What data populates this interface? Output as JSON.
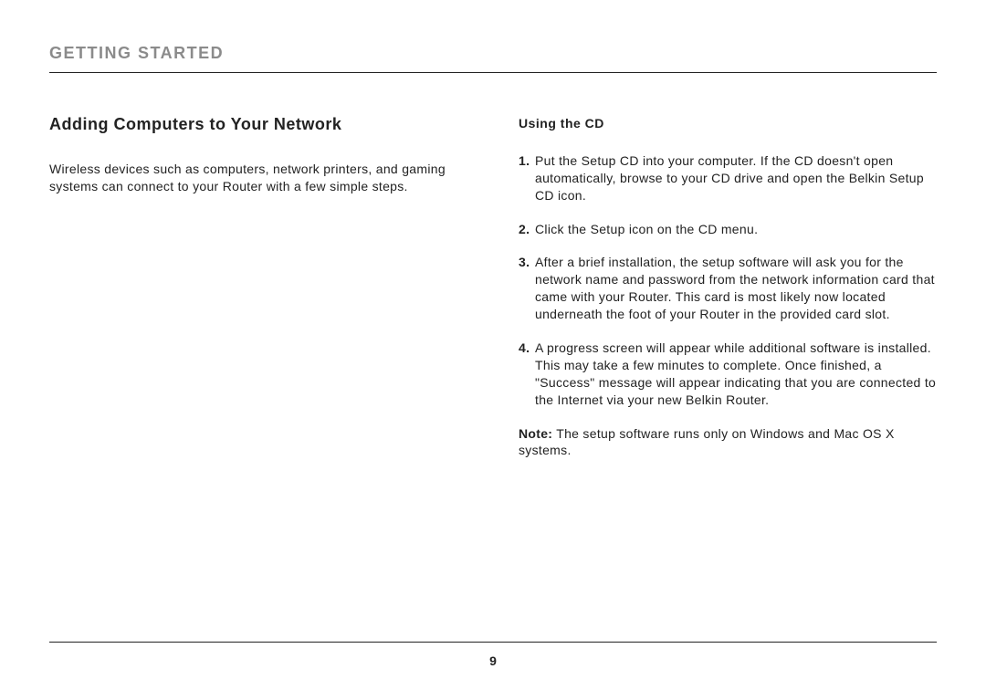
{
  "header": {
    "section_title": "GETTING STARTED"
  },
  "left": {
    "title": "Adding Computers to Your Network",
    "intro": "Wireless devices such as computers, network printers, and gaming systems can connect to your Router with a few simple steps."
  },
  "right": {
    "subhead": "Using the CD",
    "steps": [
      {
        "num": "1.",
        "text": "Put the Setup CD into your computer. If the CD doesn't open automatically, browse to your CD drive and open the Belkin Setup CD icon."
      },
      {
        "num": "2.",
        "text": "Click the Setup icon on the CD menu."
      },
      {
        "num": "3.",
        "text": "After a brief installation, the setup software will ask you for the network name and password from the network information card that came with your Router. This card is most likely now located underneath the foot of your Router in the provided card slot."
      },
      {
        "num": "4.",
        "text": "A progress screen will appear while additional software is installed. This may take a few minutes to complete. Once finished, a \"Success\" message will appear indicating that you are connected to the Internet via your new Belkin Router."
      }
    ],
    "note_label": "Note:",
    "note_text": " The setup software runs only on Windows and Mac OS X systems."
  },
  "footer": {
    "page_number": "9"
  }
}
